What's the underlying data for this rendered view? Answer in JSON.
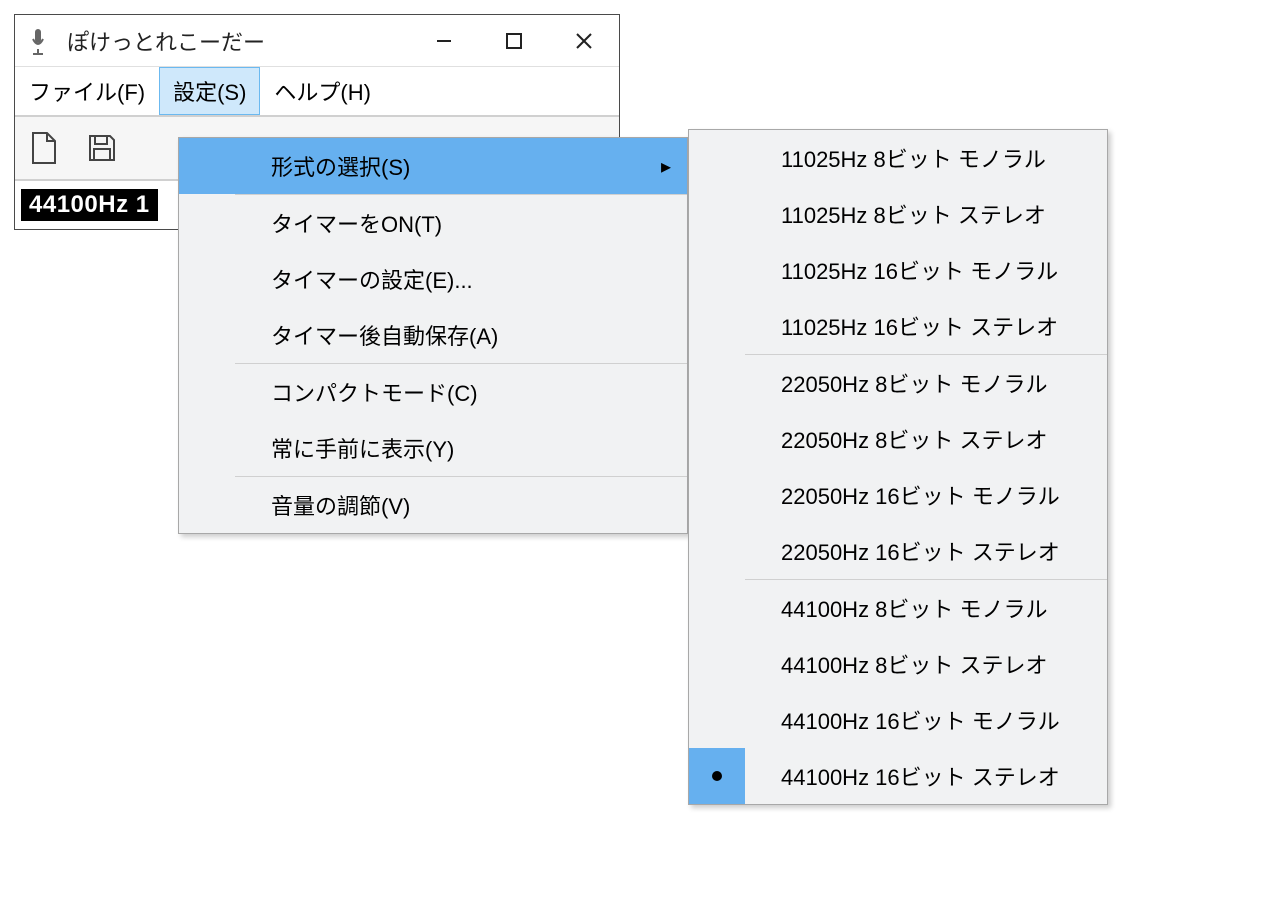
{
  "window": {
    "title": "ぽけっとれこーだー"
  },
  "menubar": {
    "file": "ファイル(F)",
    "settings": "設定(S)",
    "help": "ヘルプ(H)"
  },
  "status": {
    "format_short": "44100Hz 1"
  },
  "settings_menu": {
    "items": {
      "format_select": "形式の選択(S)",
      "timer_on": "タイマーをON(T)",
      "timer_settings": "タイマーの設定(E)...",
      "timer_autosave": "タイマー後自動保存(A)",
      "compact_mode": "コンパクトモード(C)",
      "always_on_top": "常に手前に表示(Y)",
      "volume": "音量の調節(V)"
    }
  },
  "format_submenu": {
    "items": [
      {
        "label": "11025Hz 8ビット モノラル",
        "selected": false,
        "sep_after": false
      },
      {
        "label": "11025Hz 8ビット ステレオ",
        "selected": false,
        "sep_after": false
      },
      {
        "label": "11025Hz 16ビット モノラル",
        "selected": false,
        "sep_after": false
      },
      {
        "label": "11025Hz 16ビット ステレオ",
        "selected": false,
        "sep_after": true
      },
      {
        "label": "22050Hz 8ビット モノラル",
        "selected": false,
        "sep_after": false
      },
      {
        "label": "22050Hz 8ビット ステレオ",
        "selected": false,
        "sep_after": false
      },
      {
        "label": "22050Hz 16ビット モノラル",
        "selected": false,
        "sep_after": false
      },
      {
        "label": "22050Hz 16ビット ステレオ",
        "selected": false,
        "sep_after": true
      },
      {
        "label": "44100Hz 8ビット モノラル",
        "selected": false,
        "sep_after": false
      },
      {
        "label": "44100Hz 8ビット ステレオ",
        "selected": false,
        "sep_after": false
      },
      {
        "label": "44100Hz 16ビット モノラル",
        "selected": false,
        "sep_after": false
      },
      {
        "label": "44100Hz 16ビット ステレオ",
        "selected": true,
        "sep_after": false
      }
    ]
  }
}
